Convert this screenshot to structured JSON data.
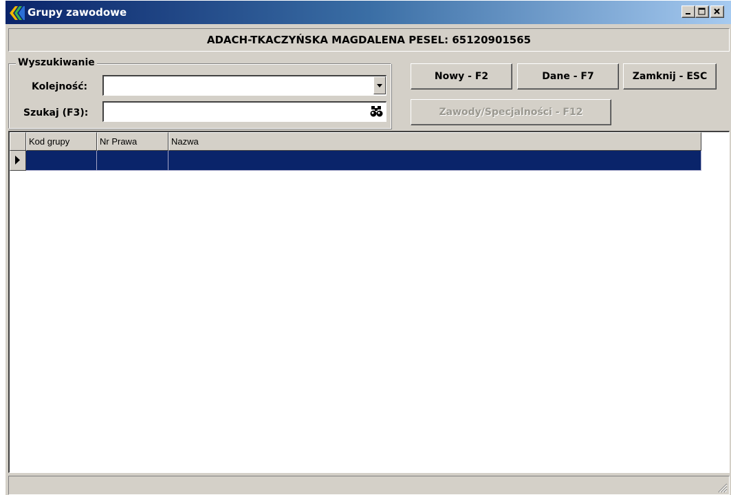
{
  "window": {
    "title": "Grupy zawodowe",
    "controls": [
      "minimize-icon",
      "maximize-icon",
      "close-icon"
    ]
  },
  "header": {
    "text": "ADACH-TKACZYŃSKA MAGDALENA  PESEL: 65120901565"
  },
  "search": {
    "group_label": "Wyszukiwanie",
    "order_label": "Kolejność:",
    "order_value": "",
    "search_label": "Szukaj (F3):",
    "search_value": ""
  },
  "buttons": {
    "new": "Nowy - F2",
    "data": "Dane - F7",
    "close": "Zamknij - ESC",
    "specialties": "Zawody/Specjalności - F12"
  },
  "grid": {
    "columns": [
      "Kod grupy",
      "Nr Prawa",
      "Nazwa"
    ],
    "rows": [
      [
        "",
        "",
        ""
      ]
    ]
  },
  "colors": {
    "titlebar_start": "#0a246a",
    "titlebar_end": "#a6caf0",
    "selection": "#0a246a",
    "face": "#d4d0c8"
  }
}
